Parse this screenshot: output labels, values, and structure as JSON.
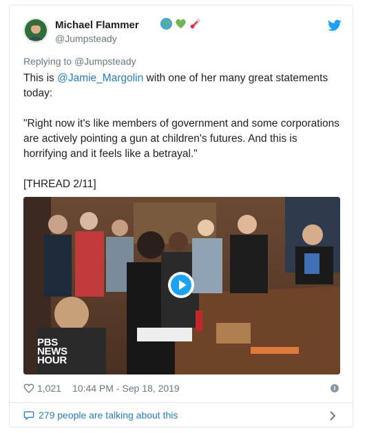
{
  "tweet": {
    "author_name": "Michael Flammer",
    "author_handle": "@Jumpsteady",
    "author_emojis": [
      "🌍",
      "💚",
      "🌡"
    ],
    "replying_to_prefix": "Replying to ",
    "replying_to_handle": "@Jumpsteady",
    "text_intro": "This is ",
    "mention": "@Jamie_Margolin",
    "text_after_mention": " with one of her many great statements today:",
    "quote": "\"Right now it's like members of government and some corporations are actively pointing a gun at children's futures. And this is horrifying and it feels like a betrayal.\"",
    "thread_label": "[THREAD 2/11]",
    "video_watermark_line1": "PBS",
    "video_watermark_line2": "NEWS",
    "video_watermark_line3": "HOUR",
    "likes": "1,021",
    "timestamp": "10:44 PM - Sep 18, 2019",
    "talking_label": "279 people are talking about this"
  },
  "colors": {
    "link": "#2b7bb9",
    "twitter_blue": "#1da1f2",
    "muted": "#697882",
    "border": "#e1e8ed"
  },
  "icons": {
    "brand": "twitter-bird-icon",
    "like": "heart-icon",
    "info": "info-icon",
    "comment": "speech-bubble-icon",
    "chevron": "chevron-right-icon",
    "play": "play-icon"
  }
}
